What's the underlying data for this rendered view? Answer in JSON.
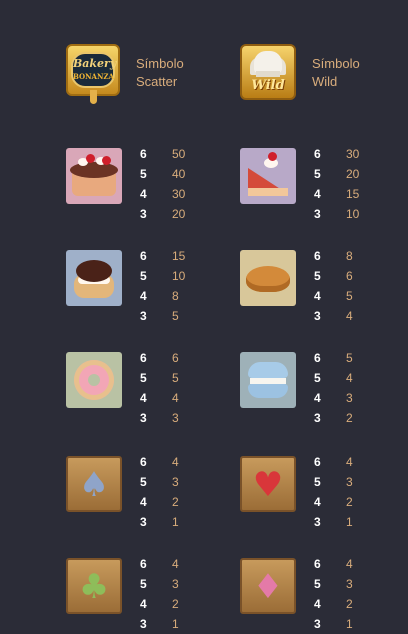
{
  "special": [
    {
      "label": "Símbolo Scatter",
      "icon": "bakery-bonanza-scatter-icon",
      "logo_text": "Bakery",
      "logo_sub": "BONANZA"
    },
    {
      "label": "Símbolo Wild",
      "icon": "chef-hat-wild-icon",
      "logo_text": "Wild"
    }
  ],
  "symbols": [
    {
      "icon": "layer-cake-icon",
      "pays": [
        {
          "n": "6",
          "v": "50"
        },
        {
          "n": "5",
          "v": "40"
        },
        {
          "n": "4",
          "v": "30"
        },
        {
          "n": "3",
          "v": "20"
        }
      ]
    },
    {
      "icon": "cake-slice-icon",
      "pays": [
        {
          "n": "6",
          "v": "30"
        },
        {
          "n": "5",
          "v": "20"
        },
        {
          "n": "4",
          "v": "15"
        },
        {
          "n": "3",
          "v": "10"
        }
      ]
    },
    {
      "icon": "cream-puff-icon",
      "pays": [
        {
          "n": "6",
          "v": "15"
        },
        {
          "n": "5",
          "v": "10"
        },
        {
          "n": "4",
          "v": "8"
        },
        {
          "n": "3",
          "v": "5"
        }
      ]
    },
    {
      "icon": "croissant-icon",
      "pays": [
        {
          "n": "6",
          "v": "8"
        },
        {
          "n": "5",
          "v": "6"
        },
        {
          "n": "4",
          "v": "5"
        },
        {
          "n": "3",
          "v": "4"
        }
      ]
    },
    {
      "icon": "donut-icon",
      "pays": [
        {
          "n": "6",
          "v": "6"
        },
        {
          "n": "5",
          "v": "5"
        },
        {
          "n": "4",
          "v": "4"
        },
        {
          "n": "3",
          "v": "3"
        }
      ]
    },
    {
      "icon": "macaron-icon",
      "pays": [
        {
          "n": "6",
          "v": "5"
        },
        {
          "n": "5",
          "v": "4"
        },
        {
          "n": "4",
          "v": "3"
        },
        {
          "n": "3",
          "v": "2"
        }
      ]
    },
    {
      "icon": "spade-icon",
      "pays": [
        {
          "n": "6",
          "v": "4"
        },
        {
          "n": "5",
          "v": "3"
        },
        {
          "n": "4",
          "v": "2"
        },
        {
          "n": "3",
          "v": "1"
        }
      ]
    },
    {
      "icon": "heart-icon",
      "pays": [
        {
          "n": "6",
          "v": "4"
        },
        {
          "n": "5",
          "v": "3"
        },
        {
          "n": "4",
          "v": "2"
        },
        {
          "n": "3",
          "v": "1"
        }
      ]
    },
    {
      "icon": "club-icon",
      "pays": [
        {
          "n": "6",
          "v": "4"
        },
        {
          "n": "5",
          "v": "3"
        },
        {
          "n": "4",
          "v": "2"
        },
        {
          "n": "3",
          "v": "1"
        }
      ]
    },
    {
      "icon": "diamond-icon",
      "pays": [
        {
          "n": "6",
          "v": "4"
        },
        {
          "n": "5",
          "v": "3"
        },
        {
          "n": "4",
          "v": "2"
        },
        {
          "n": "3",
          "v": "1"
        }
      ]
    }
  ],
  "colors": {
    "background": "#2b2c37",
    "accent": "#d9ad7c",
    "count": "#ffffff",
    "spade": "#8fa4c9",
    "heart": "#d9363a",
    "club": "#8ebd5a",
    "diamond": "#e47aa8"
  }
}
